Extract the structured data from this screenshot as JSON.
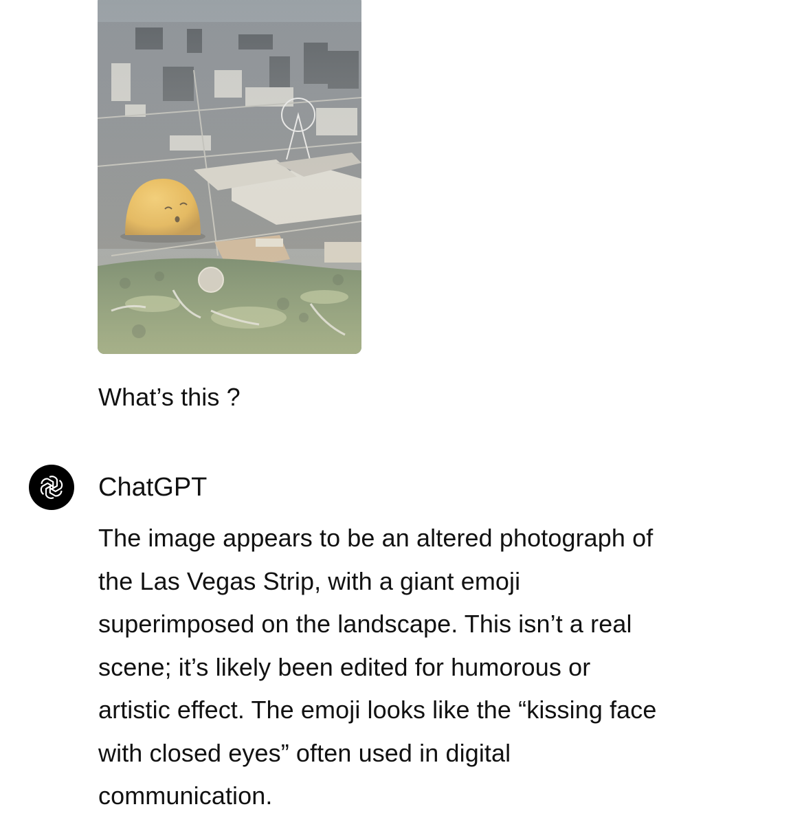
{
  "user_message": {
    "image_alt": "Aerial photograph of the Las Vegas Strip with a giant kissing-face emoji sphere",
    "text": "What’s this ?"
  },
  "assistant": {
    "avatar_icon": "openai-logo-icon",
    "name": "ChatGPT",
    "lines": [
      "The image appears to be an altered photograph of",
      "the Las Vegas Strip, with a giant emoji",
      "superimposed on the landscape. This isn’t a real",
      "scene; it’s likely been edited for humorous or",
      "artistic effect. The emoji looks like the “kissing face",
      "with closed eyes” often used in digital",
      "communication."
    ]
  },
  "colors": {
    "background": "#ffffff",
    "text": "#111111",
    "avatar_bg": "#000000",
    "emoji": "#e6a929"
  }
}
